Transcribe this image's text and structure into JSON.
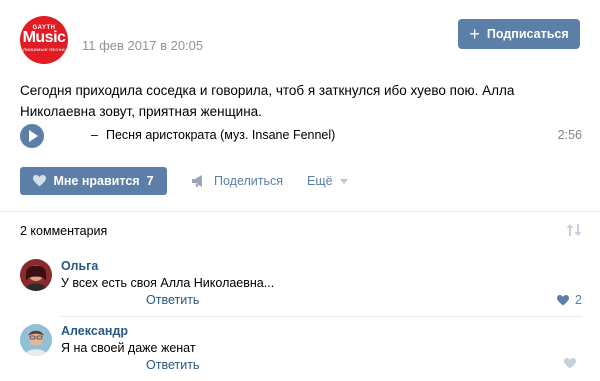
{
  "post": {
    "logo": {
      "top_text": "GAYTH",
      "main_text": "Music",
      "bottom_text": "ЛЮБИМЫЕ ПЕСНИ",
      "color": "#e11c24"
    },
    "date": "11 фев 2017 в 20:05",
    "subscribe_label": "Подписаться",
    "text": "Сегодня приходила соседка и говорила, чтоб я заткнулся ибо хуево пою. Алла Николаевна зовут, приятная женщина.",
    "audio": {
      "artist_separator": "–",
      "title": "Песня аристократа (муз. Insane Fennel)",
      "duration": "2:56"
    },
    "actions": {
      "like_label": "Мне нравится",
      "like_count": "7",
      "share_label": "Поделиться",
      "more_label": "Ещё"
    }
  },
  "comments": {
    "count_label": "2 комментария",
    "items": [
      {
        "author": "Ольга",
        "text": "У всех есть своя Алла Николаевна...",
        "reply_label": "Ответить",
        "likes": "2"
      },
      {
        "author": "Александр",
        "text": "Я на своей даже женат",
        "reply_label": "Ответить",
        "likes": ""
      }
    ]
  },
  "colors": {
    "accent": "#5b7fa6",
    "link": "#2a5885",
    "muted": "#939393",
    "divider": "#e7e8ec"
  },
  "icons": [
    "play-icon",
    "heart-icon",
    "megaphone-icon",
    "chevron-down-icon",
    "sort-icon"
  ]
}
